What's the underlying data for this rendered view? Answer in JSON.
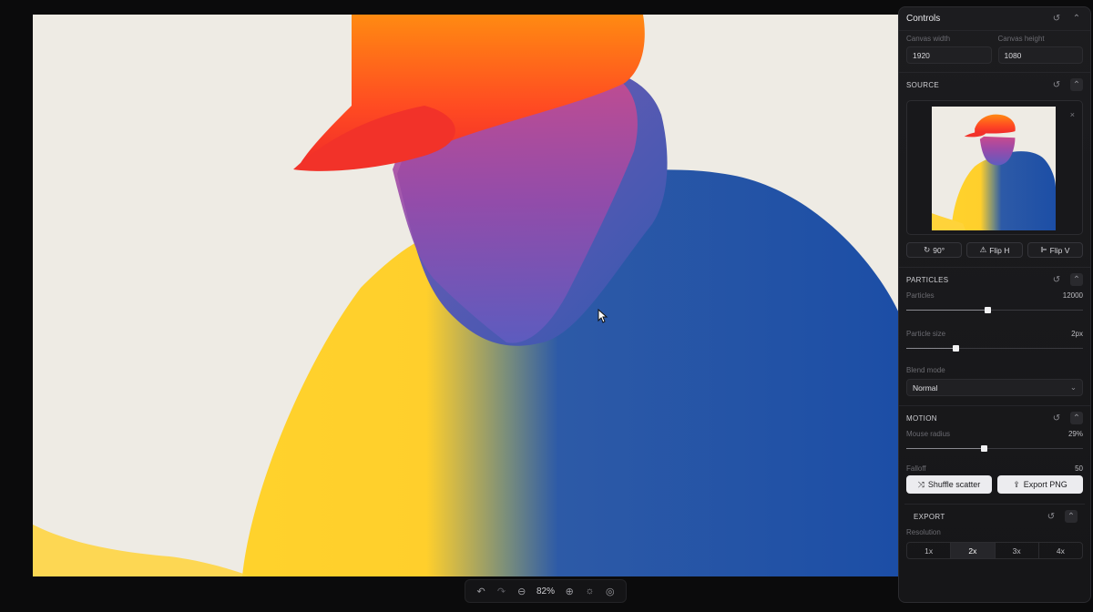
{
  "panel": {
    "title": "Controls"
  },
  "canvas": {
    "width_label": "Canvas width",
    "width_value": "1920",
    "height_label": "Canvas height",
    "height_value": "1080"
  },
  "source": {
    "title": "SOURCE",
    "rotate_label": "90°",
    "flip_h_label": "Flip H",
    "flip_v_label": "Flip V"
  },
  "particles": {
    "title": "PARTICLES",
    "count_label": "Particles",
    "count_value": "12000",
    "count_fraction": 0.46,
    "size_label": "Particle size",
    "size_value": "2px",
    "size_fraction": 0.28,
    "blend_label": "Blend mode",
    "blend_value": "Normal"
  },
  "motion": {
    "title": "MOTION",
    "radius_label": "Mouse radius",
    "radius_value": "29%",
    "radius_fraction": 0.44,
    "falloff_label": "Falloff",
    "falloff_value": "50"
  },
  "actions": {
    "shuffle_label": "Shuffle scatter",
    "export_png_label": "Export PNG"
  },
  "export": {
    "title": "EXPORT",
    "resolution_label": "Resolution",
    "options": [
      "1x",
      "2x",
      "3x",
      "4x"
    ],
    "selected": "2x"
  },
  "toolbar": {
    "zoom": "82%"
  },
  "colors": {
    "orange": "#f9482a",
    "blue": "#1c4ea6",
    "yellow": "#fbc92b",
    "background": "#eeebe4"
  }
}
